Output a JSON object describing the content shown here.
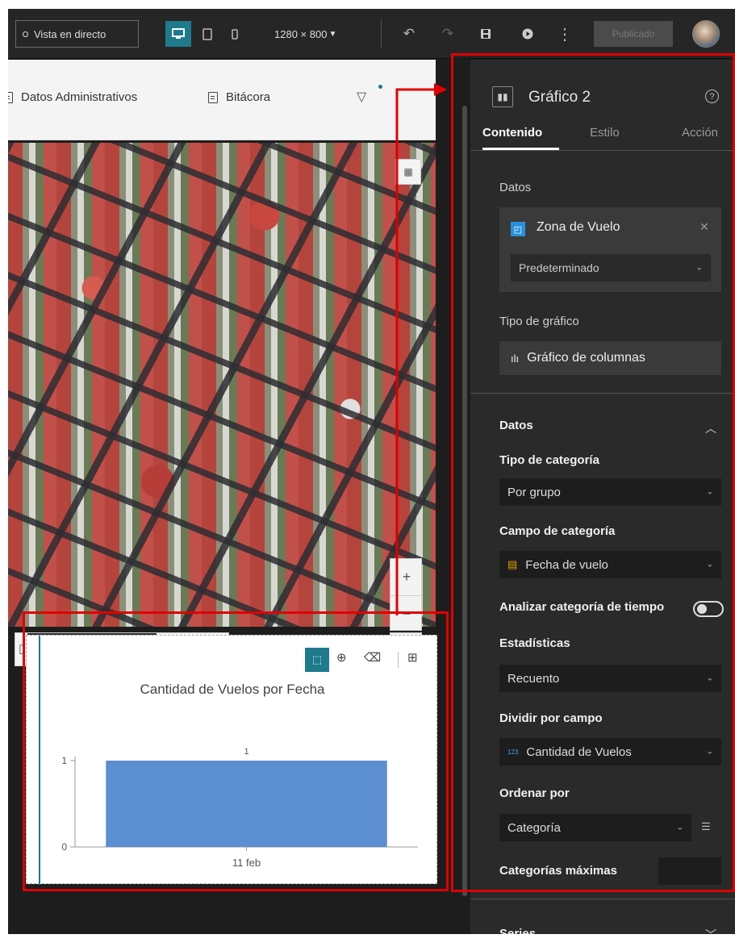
{
  "topbar": {
    "live_view": "Vista en directo",
    "resolution": "1280 × 800",
    "publish": "Publicado"
  },
  "canvas": {
    "nav": [
      "Datos Administrativos",
      "Bitácora"
    ]
  },
  "chart_widget": {
    "chart_data": {
      "type": "bar",
      "title": "Cantidad de Vuelos por Fecha",
      "categories": [
        "11 feb"
      ],
      "values": [
        1
      ],
      "data_labels": [
        "1"
      ],
      "yticks": [
        "0",
        "1"
      ],
      "ylim": [
        0,
        1
      ],
      "bar_color": "#5b8fd0"
    }
  },
  "panel": {
    "title": "Gráfico 2",
    "tabs": [
      "Contenido",
      "Estilo",
      "Acción"
    ],
    "data_label": "Datos",
    "datasource": "Zona de Vuelo",
    "view": "Predeterminado",
    "chart_type_label": "Tipo de gráfico",
    "chart_type": "Gráfico de columnas",
    "section_data": "Datos",
    "category_type_label": "Tipo de categoría",
    "category_type": "Por grupo",
    "category_field_label": "Campo de categoría",
    "category_field": "Fecha de vuelo",
    "time_label": "Analizar categoría de tiempo",
    "stats_label": "Estadísticas",
    "stats": "Recuento",
    "split_label": "Dividir por campo",
    "split_field": "Cantidad de Vuelos",
    "order_label": "Ordenar por",
    "order": "Categoría",
    "max_label": "Categorías máximas",
    "series": "Series"
  },
  "colors": {
    "accent": "#1f7a8c",
    "highlight": "#e00000"
  }
}
